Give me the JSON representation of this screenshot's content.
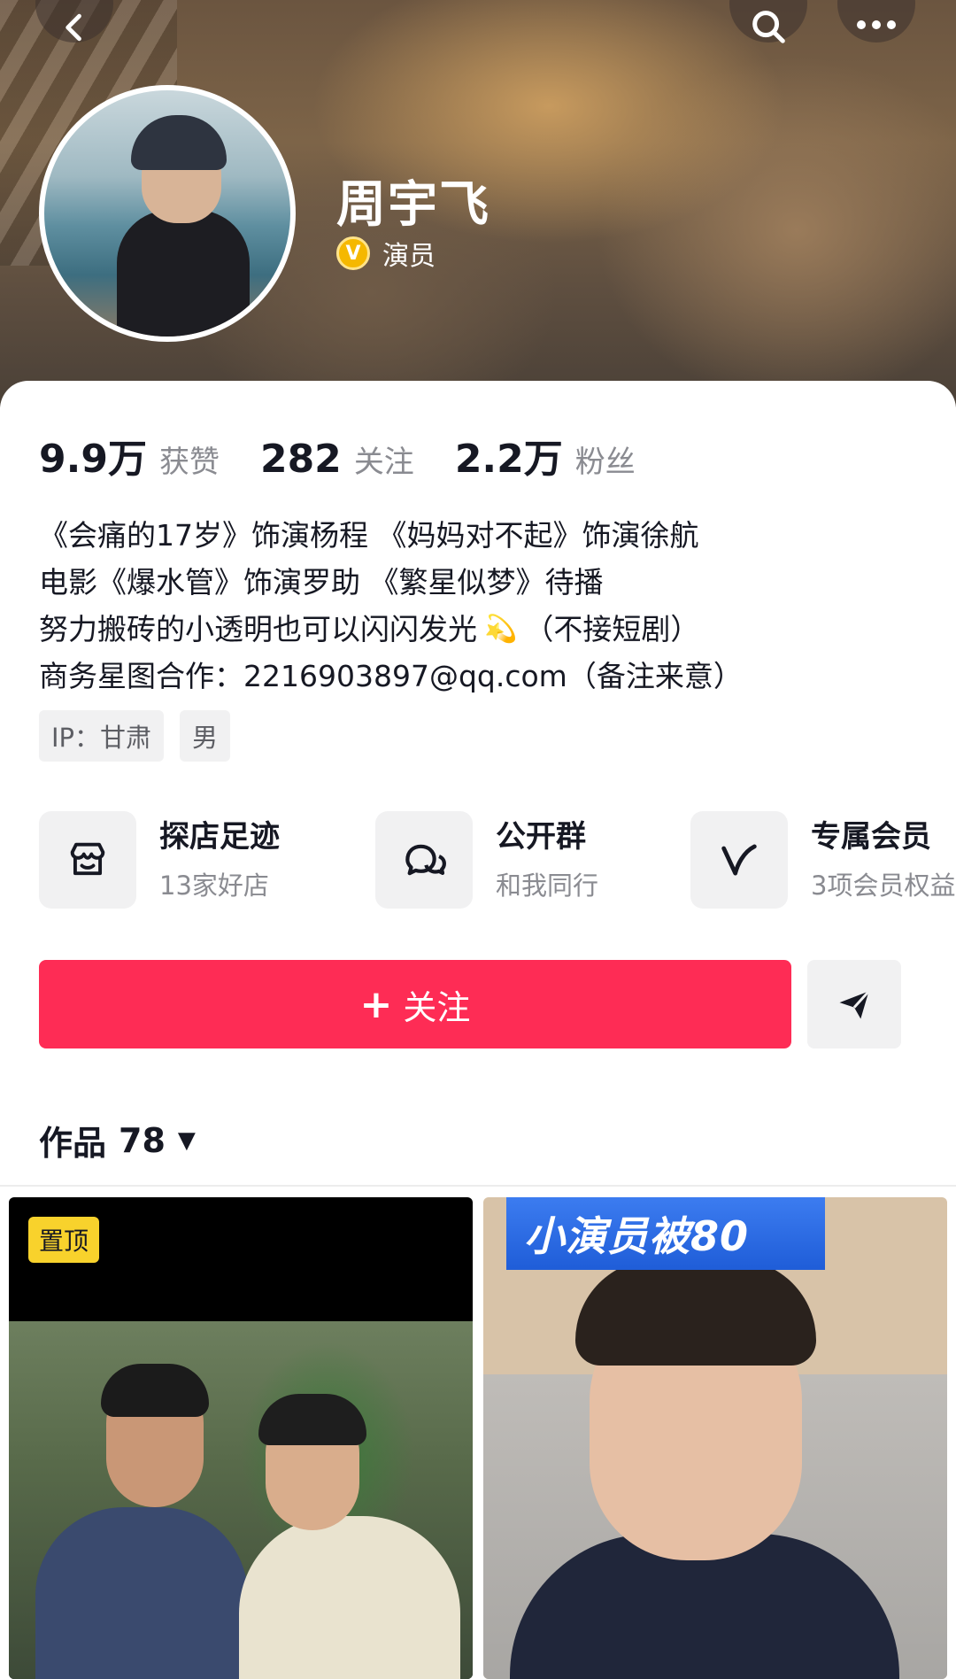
{
  "header": {
    "back_icon": "chevron-left-icon",
    "search_icon": "search-icon",
    "more_icon": "more-dots-icon"
  },
  "profile": {
    "name": "周宇飞",
    "verified_badge": "V",
    "verified_label": "演员"
  },
  "stats": [
    {
      "value": "9.9万",
      "label": "获赞"
    },
    {
      "value": "282",
      "label": "关注"
    },
    {
      "value": "2.2万",
      "label": "粉丝"
    }
  ],
  "bio": {
    "line1": "《会痛的17岁》饰演杨程  《妈妈对不起》饰演徐航",
    "line2": "电影《爆水管》饰演罗助  《繁星似梦》待播",
    "line3a": "努力搬砖的小透明也可以闪闪发光",
    "line3_emoji": "💫",
    "line3b": "（不接短剧）",
    "line4": "商务星图合作：2216903897@qq.com（备注来意）"
  },
  "tags": [
    "IP：甘肃",
    "男"
  ],
  "features": [
    {
      "title": "探店足迹",
      "subtitle": "13家好店",
      "icon": "shop-icon"
    },
    {
      "title": "公开群",
      "subtitle": "和我同行",
      "icon": "chat-bubbles-icon"
    },
    {
      "title": "专属会员",
      "subtitle": "3项会员权益",
      "icon": "vip-v-icon"
    }
  ],
  "actions": {
    "follow_label": "关注",
    "follow_plus": "+",
    "share_icon": "send-icon"
  },
  "works": {
    "label": "作品",
    "count": "78",
    "caret": "▼"
  },
  "videos": [
    {
      "pinned_label": "置顶"
    },
    {
      "caption": "小演员被80"
    }
  ],
  "colors": {
    "accent": "#fe2c55",
    "pin": "#f8d22c",
    "verified": "#f5b800"
  }
}
